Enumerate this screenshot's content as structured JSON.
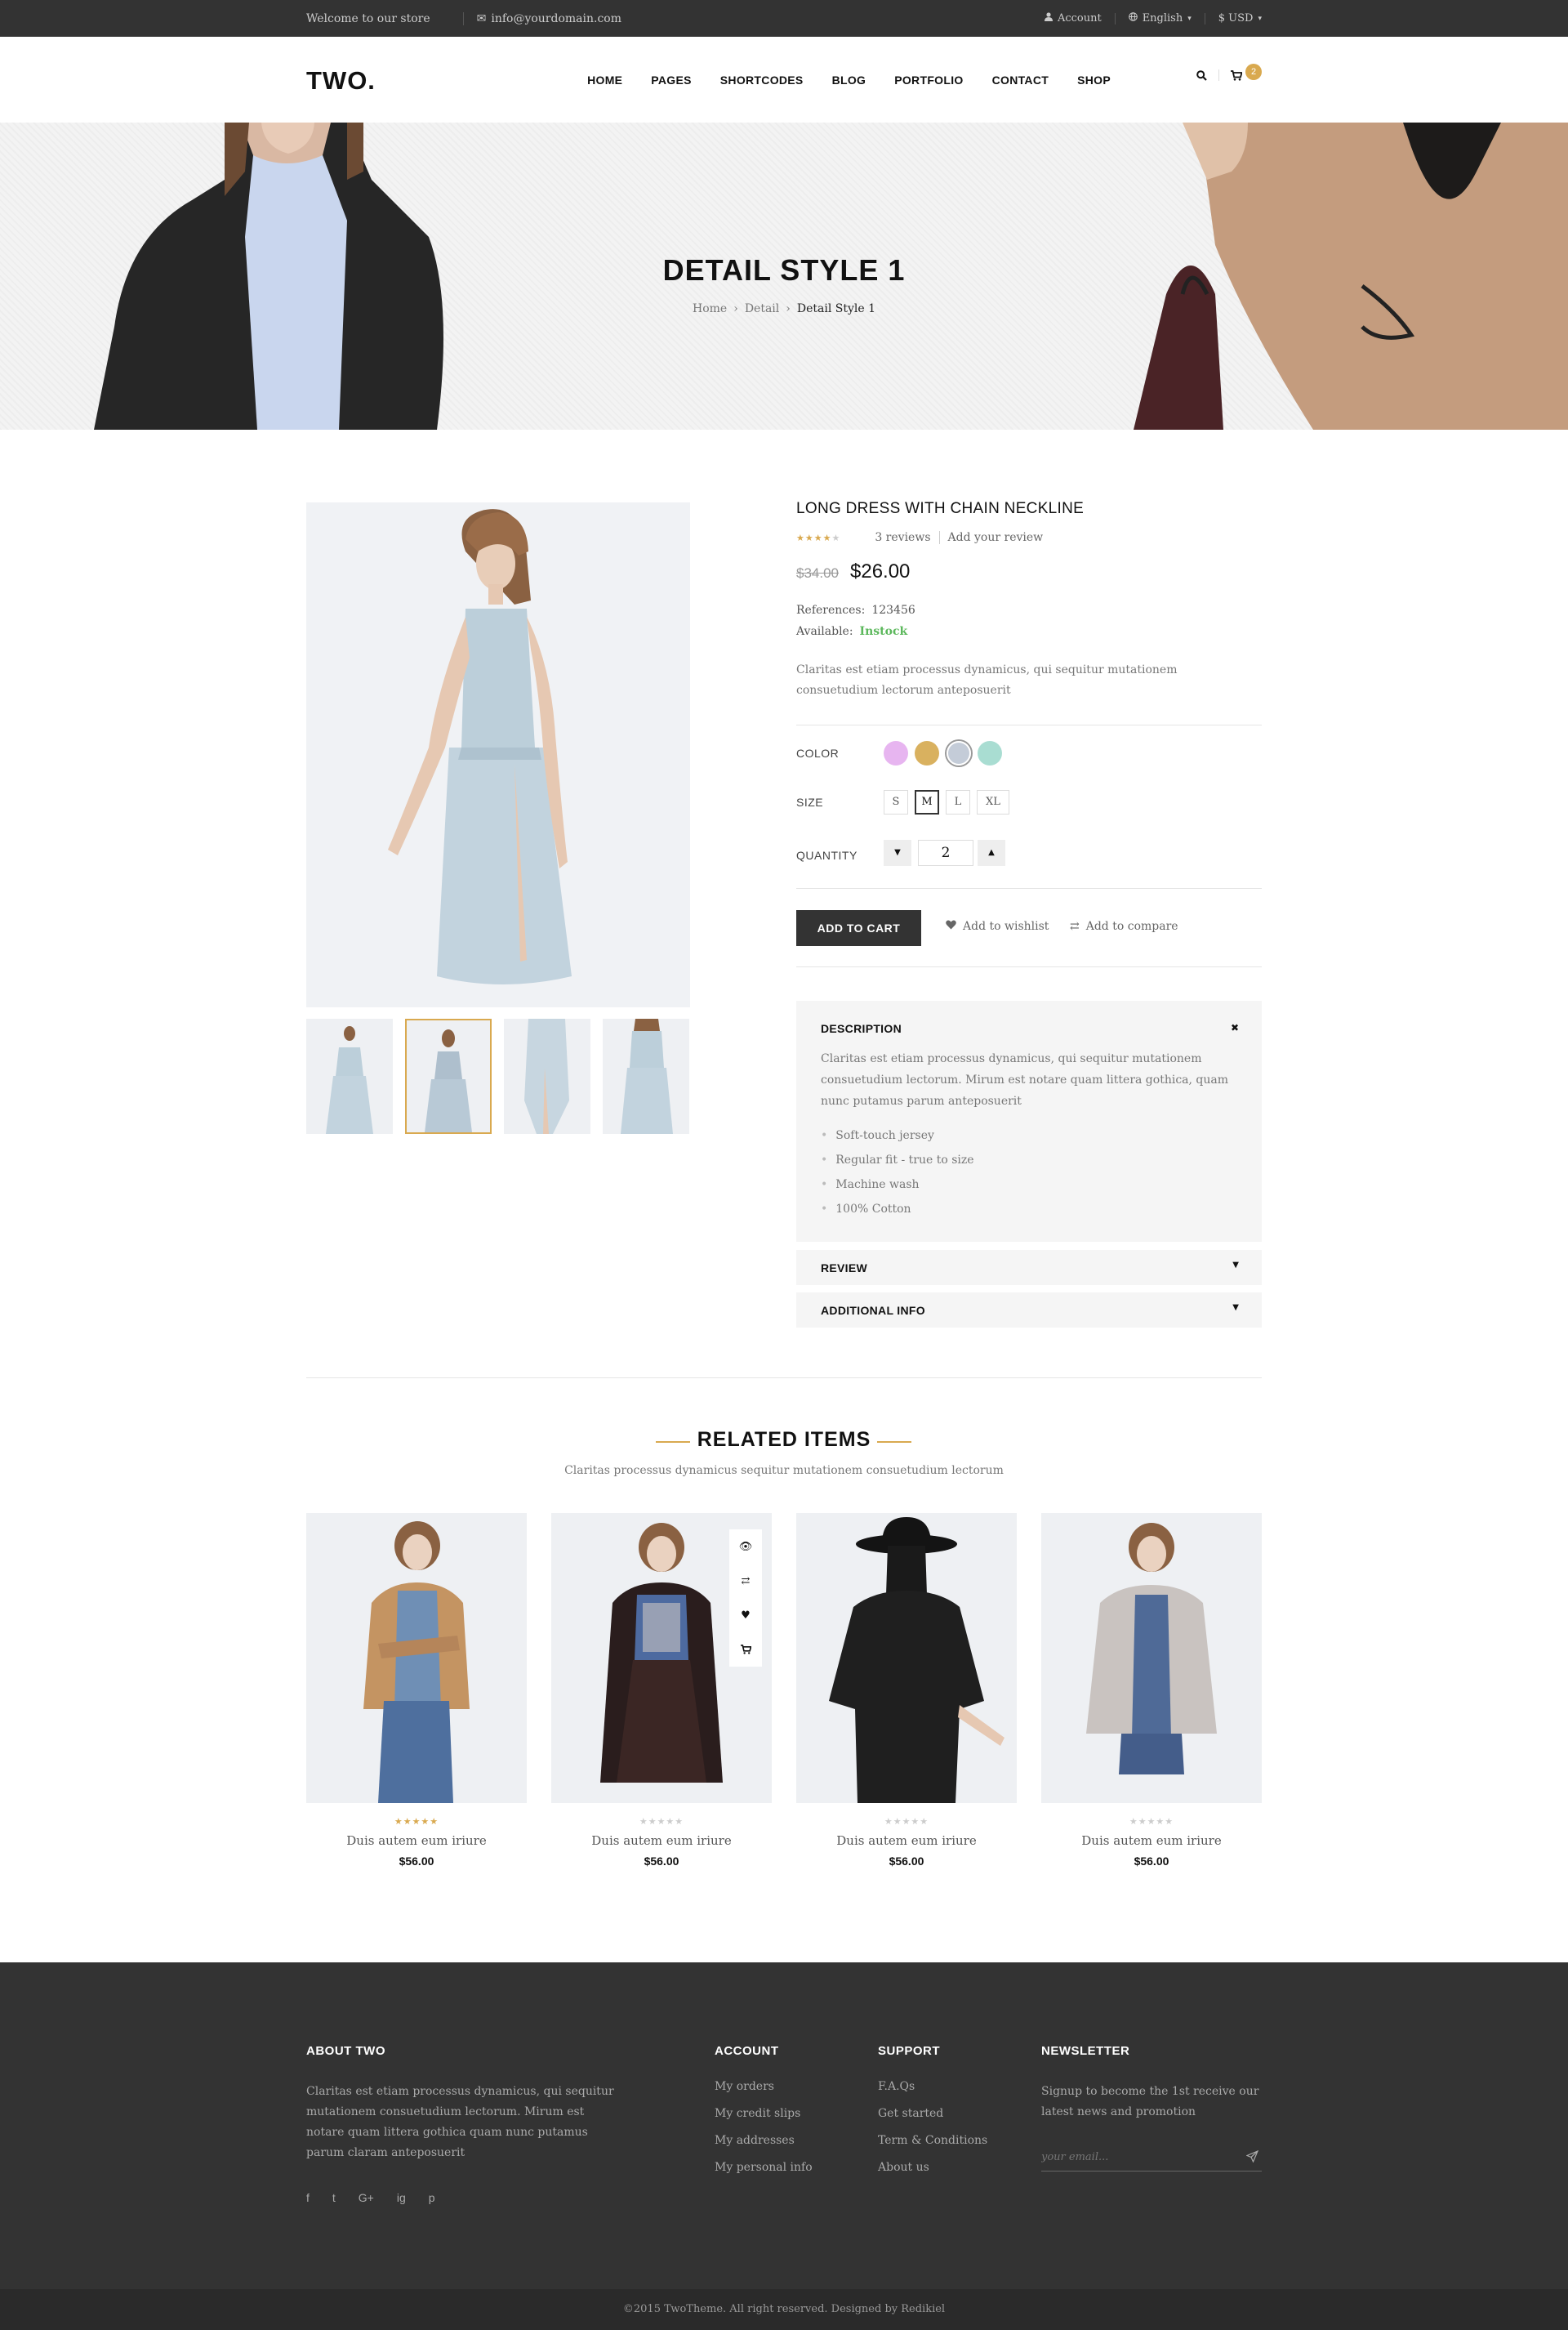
{
  "topbar": {
    "welcome": "Welcome to our store",
    "email": "info@yourdomain.com",
    "account": "Account",
    "language": "English",
    "currency": "$ USD"
  },
  "header": {
    "logo": "TWO.",
    "nav": [
      "HOME",
      "PAGES",
      "SHORTCODES",
      "BLOG",
      "PORTFOLIO",
      "CONTACT",
      "SHOP"
    ],
    "cart_count": "2"
  },
  "hero": {
    "title": "DETAIL STYLE 1",
    "breadcrumb": [
      "Home",
      "Detail",
      "Detail Style 1"
    ]
  },
  "product": {
    "title": "LONG DRESS WITH CHAIN NECKLINE",
    "rating": 4,
    "reviews": "3 reviews",
    "add_review": "Add your review",
    "old_price": "$34.00",
    "price": "$26.00",
    "ref_label": "References:",
    "ref_value": "123456",
    "avail_label": "Available:",
    "avail_value": "Instock",
    "description": "Claritas est etiam processus dynamicus, qui sequitur mutationem consuetudium lectorum anteposuerit",
    "color_label": "COLOR",
    "colors": [
      "#e7b5f0",
      "#d9b15f",
      "#c4ccd8",
      "#a9ddd2"
    ],
    "selected_color": 2,
    "size_label": "SIZE",
    "sizes": [
      "S",
      "M",
      "L",
      "XL"
    ],
    "selected_size": 1,
    "quantity_label": "QUANTITY",
    "quantity": "2",
    "add_to_cart": "ADD TO  CART",
    "wishlist": "Add to wishlist",
    "compare": "Add to compare"
  },
  "tabs": {
    "description_title": "DESCRIPTION",
    "description_text": "Claritas est etiam processus dynamicus, qui sequitur mutationem consuetudium lectorum. Mirum est notare quam littera gothica, quam nunc putamus parum anteposuerit",
    "features": [
      "Soft-touch jersey",
      "Regular fit - true to size",
      "Machine wash",
      "100% Cotton"
    ],
    "review_title": "REVIEW",
    "additional_title": "ADDITIONAL INFO"
  },
  "related": {
    "title": "RELATED ITEMS",
    "subtitle": "Claritas processus dynamicus sequitur mutationem consuetudium lectorum",
    "items": [
      {
        "name": "Duis autem eum iriure",
        "price": "$56.00",
        "rating": 5
      },
      {
        "name": "Duis autem eum iriure",
        "price": "$56.00",
        "rating": 0
      },
      {
        "name": "Duis autem eum iriure",
        "price": "$56.00",
        "rating": 0
      },
      {
        "name": "Duis autem eum iriure",
        "price": "$56.00",
        "rating": 0
      }
    ]
  },
  "footer": {
    "about_title": "ABOUT TWO",
    "about_text": "Claritas est etiam processus dynamicus, qui sequitur mutationem consuetudium lectorum. Mirum est notare quam littera gothica quam nunc putamus parum claram anteposuerit",
    "social": [
      "f",
      "t",
      "G+",
      "ig",
      "p"
    ],
    "account_title": "ACCOUNT",
    "account_links": [
      "My orders",
      "My credit slips",
      "My addresses",
      "My personal info"
    ],
    "support_title": "SUPPORT",
    "support_links": [
      "F.A.Qs",
      "Get started",
      "Term & Conditions",
      "About us"
    ],
    "newsletter_title": "NEWSLETTER",
    "newsletter_text": "Signup to become the 1st receive our latest news and promotion",
    "email_placeholder": "your email...",
    "copyright": "©2015 TwoTheme. All right reserved. Designed by Redikiel"
  }
}
